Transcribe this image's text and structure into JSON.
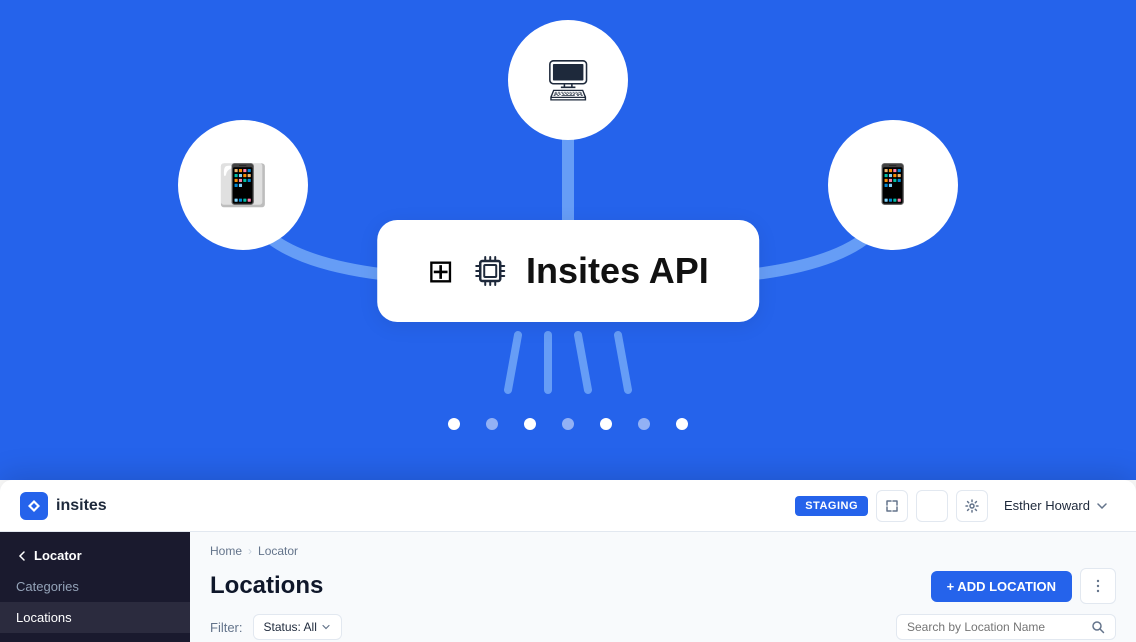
{
  "hero": {
    "api_card_title": "Insites API"
  },
  "topbar": {
    "logo_text": "insites",
    "staging_badge": "STAGING",
    "user_name": "Esther Howard",
    "expand_icon": "⤢",
    "theme_icon": "☽",
    "settings_icon": "⚙",
    "chevron_icon": "❯"
  },
  "sidebar": {
    "back_label": "Locator",
    "items": [
      {
        "label": "Categories",
        "active": false
      },
      {
        "label": "Locations",
        "active": true
      }
    ]
  },
  "breadcrumb": {
    "items": [
      "Home",
      "Locator"
    ]
  },
  "content": {
    "page_title": "Locations",
    "add_button_label": "+ ADD LOCATION",
    "filter_label": "Filter:",
    "filter_value": "Status: All",
    "filter_chevron": "▾",
    "search_placeholder": "Search by Location Name",
    "more_icon": "⋮"
  },
  "dots": [
    {
      "filled": true
    },
    {
      "filled": false
    },
    {
      "filled": true
    },
    {
      "filled": false
    },
    {
      "filled": true
    },
    {
      "filled": false
    },
    {
      "filled": true
    }
  ]
}
